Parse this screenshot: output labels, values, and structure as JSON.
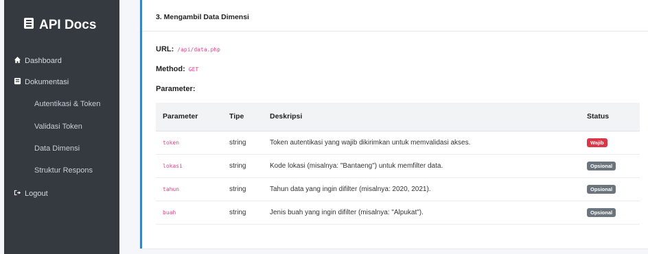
{
  "sidebar": {
    "brand": "API Docs",
    "items": [
      {
        "label": "Dashboard"
      },
      {
        "label": "Dokumentasi"
      }
    ],
    "sub_items": [
      {
        "label": "Autentikasi & Token"
      },
      {
        "label": "Validasi Token"
      },
      {
        "label": "Data Dimensi"
      },
      {
        "label": "Struktur Respons"
      }
    ],
    "logout": "Logout"
  },
  "section": {
    "title": "3. Mengambil Data Dimensi",
    "url_label": "URL:",
    "url_value": "/api/data.php",
    "method_label": "Method:",
    "method_value": "GET",
    "parameter_label": "Parameter:"
  },
  "table": {
    "headers": [
      "Parameter",
      "Tipe",
      "Deskripsi",
      "Status"
    ],
    "rows": [
      {
        "param": "token",
        "tipe": "string",
        "desc": "Token autentikasi yang wajib dikirimkan untuk memvalidasi akses.",
        "status": "Wajib"
      },
      {
        "param": "lokasi",
        "tipe": "string",
        "desc": "Kode lokasi (misalnya: \"Bantaeng\") untuk memfilter data.",
        "status": "Opsional"
      },
      {
        "param": "tahun",
        "tipe": "string",
        "desc": "Tahun data yang ingin difilter (misalnya: 2020, 2021).",
        "status": "Opsional"
      },
      {
        "param": "buah",
        "tipe": "string",
        "desc": "Jenis buah yang ingin difilter (misalnya: \"Alpukat\").",
        "status": "Opsional"
      }
    ]
  },
  "colors": {
    "sidebar_bg": "#343a40",
    "accent": "#3b82c4",
    "badge_required": "#dc3545",
    "badge_optional": "#6c757d",
    "code": "#e83e8c"
  }
}
